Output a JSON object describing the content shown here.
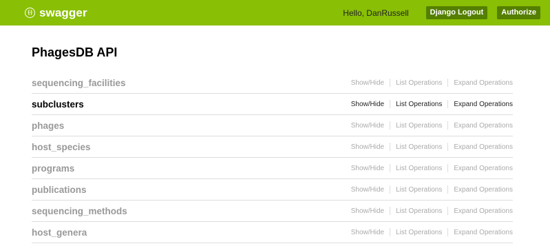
{
  "header": {
    "logo_glyph": "{-}",
    "logo_text": "swagger",
    "greeting": "Hello, DanRussell",
    "logout_label": "Django Logout",
    "authorize_label": "Authorize",
    "brand_color": "#89bf04",
    "button_color": "#547f00"
  },
  "page": {
    "title": "PhagesDB API"
  },
  "ops_labels": {
    "show_hide": "Show/Hide",
    "list_operations": "List Operations",
    "expand_operations": "Expand Operations"
  },
  "resources": [
    {
      "name": "sequencing_facilities",
      "active": false
    },
    {
      "name": "subclusters",
      "active": true
    },
    {
      "name": "phages",
      "active": false
    },
    {
      "name": "host_species",
      "active": false
    },
    {
      "name": "programs",
      "active": false
    },
    {
      "name": "publications",
      "active": false
    },
    {
      "name": "sequencing_methods",
      "active": false
    },
    {
      "name": "host_genera",
      "active": false
    }
  ]
}
